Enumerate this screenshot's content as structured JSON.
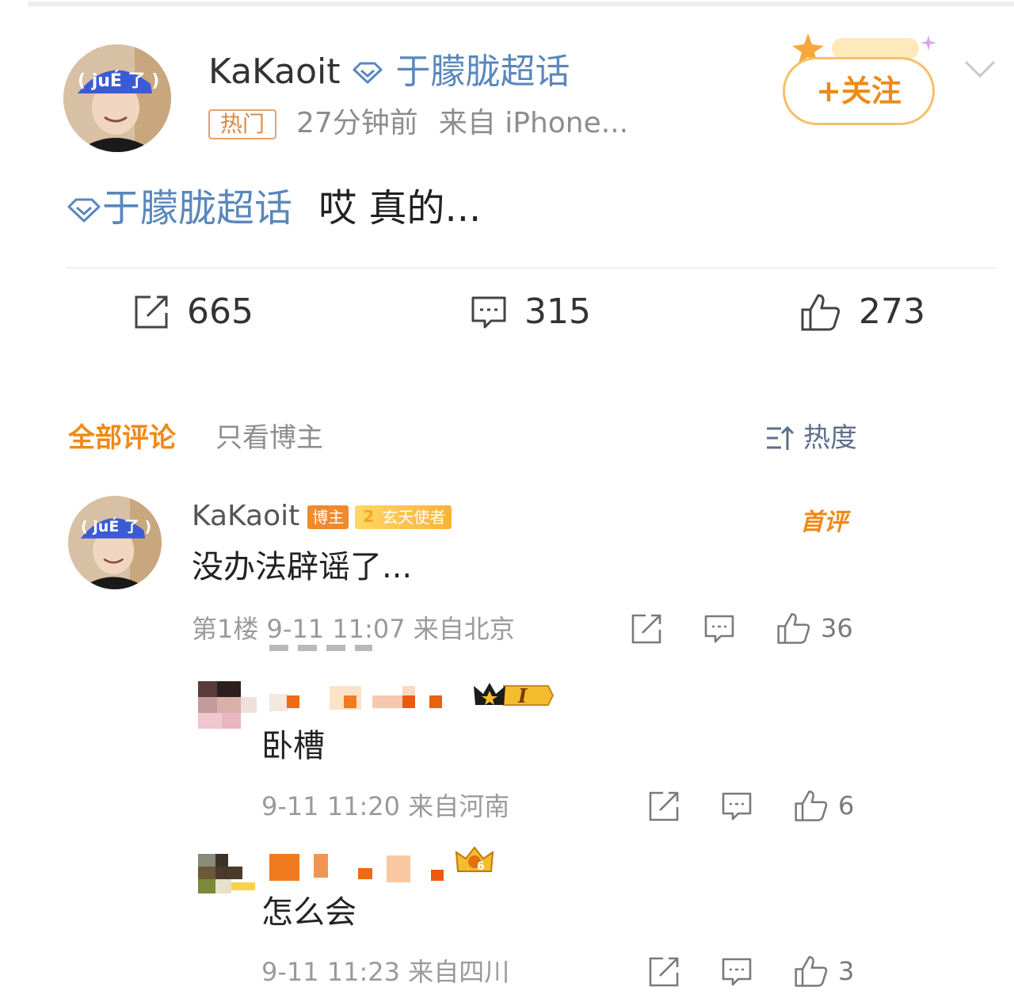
{
  "post": {
    "author": "KaKaoit",
    "topic": "于朦胧超话",
    "hot_badge": "热门",
    "time": "27分钟前",
    "source": "来自 iPhone...",
    "follow_label": "+关注",
    "text_topic": "于朦胧超话",
    "text_body": "哎 真的...",
    "avatar_cap_text": "( juÉ 了 )",
    "stats": {
      "reposts": "665",
      "comments": "315",
      "likes": "273"
    }
  },
  "tabs": {
    "all": "全部评论",
    "owner_only": "只看博主",
    "sort": "热度"
  },
  "comments": [
    {
      "name": "KaKaoit",
      "owner_badge": "博主",
      "fan_level": "2",
      "fan_title": "玄天使者",
      "tag": "首评",
      "text": "没办法辟谣了...",
      "floor": "第1楼",
      "time": "9-11 11:07",
      "location": "来自北京",
      "likes": "36"
    }
  ],
  "replies": [
    {
      "text": "卧槽",
      "time": "9-11 11:20",
      "location": "来自河南",
      "likes": "6",
      "crown_level": "I"
    },
    {
      "text": "怎么会",
      "time": "9-11 11:23",
      "location": "来自四川",
      "likes": "3",
      "crown_level": "6"
    }
  ],
  "colors": {
    "accent_orange": "#ee8a17",
    "topic_blue": "#5a87bd",
    "meta_gray": "#9a9a9a"
  },
  "icons": [
    "diamond-icon",
    "repost-icon",
    "comment-icon",
    "like-icon",
    "sort-icon",
    "chevron-down-icon",
    "crown-icon"
  ]
}
